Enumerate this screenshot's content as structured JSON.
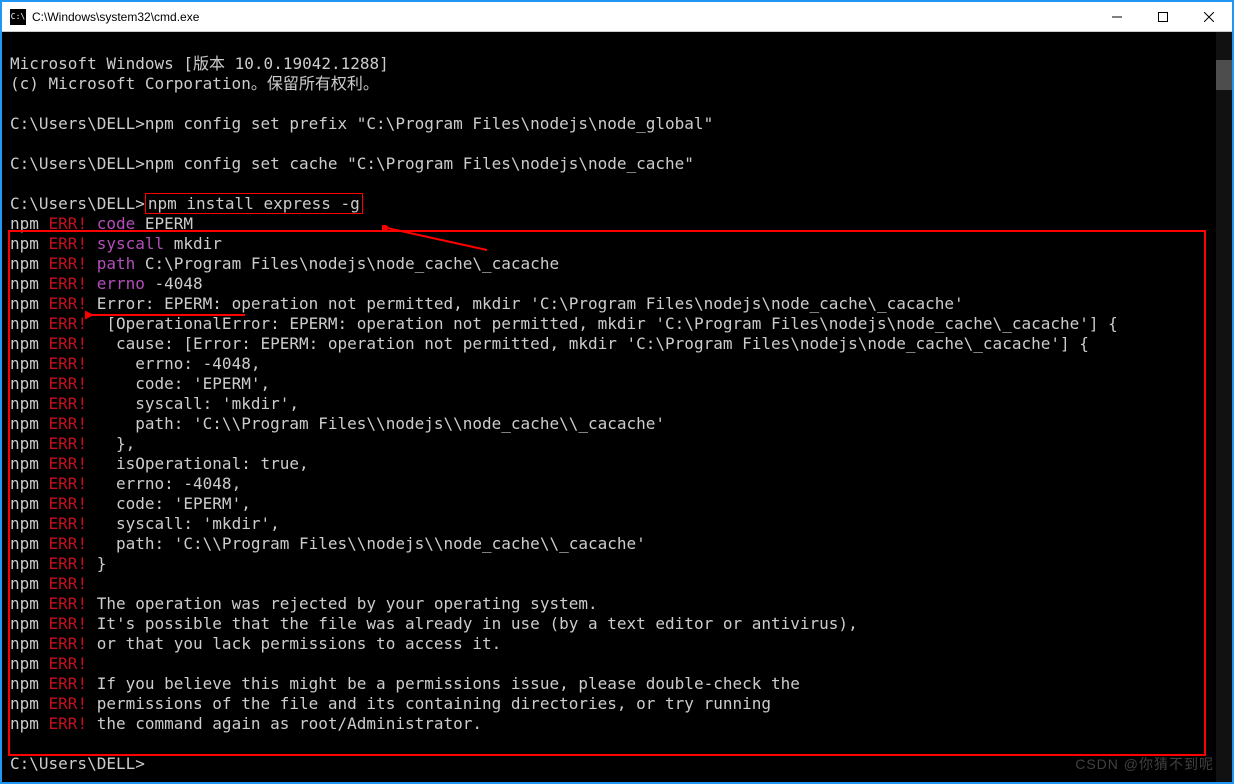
{
  "window": {
    "icon_text": "C:\\",
    "title": "C:\\Windows\\system32\\cmd.exe"
  },
  "lines": {
    "winver": "Microsoft Windows [版本 10.0.19042.1288]",
    "copyright": "(c) Microsoft Corporation。保留所有权利。",
    "prompt1_path": "C:\\Users\\DELL>",
    "cmd1": "npm config set prefix \"C:\\Program Files\\nodejs\\node_global\"",
    "prompt2_path": "C:\\Users\\DELL>",
    "cmd2": "npm config set cache \"C:\\Program Files\\nodejs\\node_cache\"",
    "prompt3_path": "C:\\Users\\DELL>",
    "cmd3": "npm install express -g",
    "prompt4_path": "C:\\Users\\DELL>"
  },
  "err": {
    "npm": "npm",
    "ERR": " ERR! ",
    "l1a": "code",
    "l1b": " EPERM",
    "l2a": "syscall",
    "l2b": " mkdir",
    "l3a": "path",
    "l3b": " C:\\Program Files\\nodejs\\node_cache\\_cacache",
    "l4a": "errno",
    "l4b": " -4048",
    "l5": "Error: EPERM: operation not permitted, mkdir 'C:\\Program Files\\nodejs\\node_cache\\_cacache'",
    "l6": " [OperationalError: EPERM: operation not permitted, mkdir 'C:\\Program Files\\nodejs\\node_cache\\_cacache'] {",
    "l7": "  cause: [Error: EPERM: operation not permitted, mkdir 'C:\\Program Files\\nodejs\\node_cache\\_cacache'] {",
    "l8": "    errno: -4048,",
    "l9": "    code: 'EPERM',",
    "l10": "    syscall: 'mkdir',",
    "l11": "    path: 'C:\\\\Program Files\\\\nodejs\\\\node_cache\\\\_cacache'",
    "l12": "  },",
    "l13": "  isOperational: true,",
    "l14": "  errno: -4048,",
    "l15": "  code: 'EPERM',",
    "l16": "  syscall: 'mkdir',",
    "l17": "  path: 'C:\\\\Program Files\\\\nodejs\\\\node_cache\\\\_cacache'",
    "l18": "}",
    "l19": "",
    "l20": "The operation was rejected by your operating system.",
    "l21": "It's possible that the file was already in use (by a text editor or antivirus),",
    "l22": "or that you lack permissions to access it.",
    "l23": "",
    "l24": "If you believe this might be a permissions issue, please double-check the",
    "l25": "permissions of the file and its containing directories, or try running",
    "l26": "the command again as root/Administrator."
  },
  "watermark": "CSDN @你猜不到呢"
}
